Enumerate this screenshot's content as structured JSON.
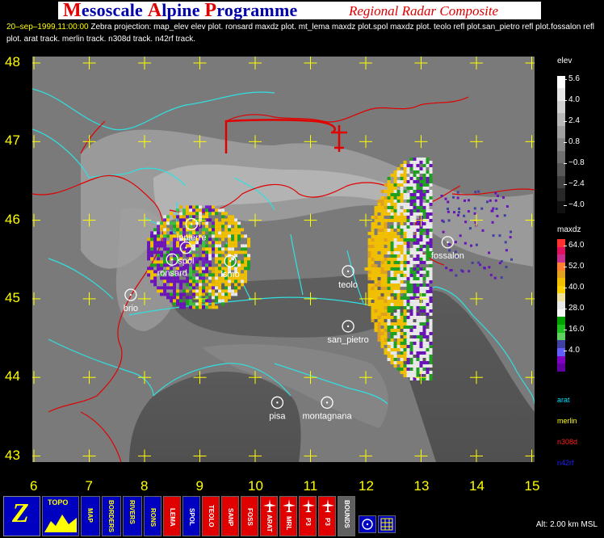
{
  "header": {
    "title_parts": [
      {
        "cap": "M",
        "rest": "esoscale "
      },
      {
        "cap": "A",
        "rest": "lpine "
      },
      {
        "cap": "P",
        "rest": "rogramme"
      }
    ],
    "subtitle": "Regional Radar Composite"
  },
  "description": {
    "datetime": "20–sep–1999,11:00:00",
    "text": "Zebra projection: map_elev elev plot.  ronsard maxdz plot.  mt_lema maxdz plot.spol maxdz plot.  teolo refl plot.san_pietro refl plot.fossalon refl plot.  arat track.  merlin track.  n308d track.  n42rf track."
  },
  "axes": {
    "y_labels": [
      "48",
      "47",
      "46",
      "45",
      "44",
      "43"
    ],
    "x_labels": [
      "6",
      "7",
      "8",
      "9",
      "10",
      "11",
      "12",
      "13",
      "14",
      "15"
    ]
  },
  "stations": [
    {
      "name": "lnpierre",
      "lon": 8.85,
      "lat": 45.95
    },
    {
      "name": "spol",
      "lon": 8.75,
      "lat": 45.65
    },
    {
      "name": "ronsard",
      "lon": 8.5,
      "lat": 45.5
    },
    {
      "name": "lsmo",
      "lon": 9.55,
      "lat": 45.48
    },
    {
      "name": "brio",
      "lon": 7.75,
      "lat": 45.05
    },
    {
      "name": "teolo",
      "lon": 11.68,
      "lat": 45.35
    },
    {
      "name": "san_pietro",
      "lon": 11.68,
      "lat": 44.65
    },
    {
      "name": "fossalon",
      "lon": 13.48,
      "lat": 45.72
    },
    {
      "name": "pisa",
      "lon": 10.4,
      "lat": 43.68
    },
    {
      "name": "montagnana",
      "lon": 11.3,
      "lat": 43.68
    }
  ],
  "legend_elev": {
    "title": "elev",
    "ticks": [
      "5.6",
      "4.0",
      "2.4",
      "0.8",
      "−0.8",
      "−2.4",
      "−4.0"
    ],
    "colors": [
      "#ffffff",
      "#e8e8e8",
      "#d0d0d0",
      "#b8b8b8",
      "#a0a0a0",
      "#888888",
      "#707070",
      "#585858",
      "#404040",
      "#282828",
      "#101010"
    ]
  },
  "legend_maxdz": {
    "title": "maxdz",
    "ticks": [
      "64.0",
      "52.0",
      "40.0",
      "28.0",
      "16.0",
      "4.0"
    ],
    "colors": [
      "#ff3030",
      "#e01060",
      "#c83090",
      "#ff8030",
      "#e0a020",
      "#f0c000",
      "#ffd000",
      "#f0e0a0",
      "#e8e8e8",
      "#f8f8f8",
      "#00a000",
      "#20c020",
      "#60d060",
      "#4040a0",
      "#6060ff",
      "#8000c0",
      "#6000a0"
    ]
  },
  "tracks": [
    {
      "name": "arat",
      "color": "#00e0ff"
    },
    {
      "name": "merlin",
      "color": "#ffff00"
    },
    {
      "name": "n308d",
      "color": "#ff2020"
    },
    {
      "name": "n42rf",
      "color": "#2020ff"
    }
  ],
  "toolbar": {
    "items": [
      {
        "name": "zebra-logo",
        "label": "Z"
      },
      {
        "name": "topo-button",
        "label": "TOPO"
      },
      {
        "name": "map-button",
        "label": "MAP"
      },
      {
        "name": "borders-button",
        "label": "BORDERS"
      },
      {
        "name": "rivers-button",
        "label": "RIVERS"
      },
      {
        "name": "rons-button",
        "label": "RONS"
      },
      {
        "name": "lema-button",
        "label": "LEMA"
      },
      {
        "name": "spol-button",
        "label": "SPOL"
      },
      {
        "name": "teolo-button",
        "label": "TEOLO"
      },
      {
        "name": "sanp-button",
        "label": "SANP"
      },
      {
        "name": "foss-button",
        "label": "FOSS"
      },
      {
        "name": "arat-button",
        "label": "ARAT"
      },
      {
        "name": "mrl-button",
        "label": "MRL"
      },
      {
        "name": "p3-button",
        "label": "P3"
      },
      {
        "name": "pj-button",
        "label": "P3"
      },
      {
        "name": "bounds-button",
        "label": "BOUNDS"
      }
    ],
    "alt_text": "Alt: 2.00 km MSL"
  },
  "colors": {
    "title_red": "#e00000",
    "title_blue": "#0000a8",
    "grid_yellow": "#ffff00",
    "coast_cyan": "#30e0e0",
    "border_red": "#e00000"
  }
}
